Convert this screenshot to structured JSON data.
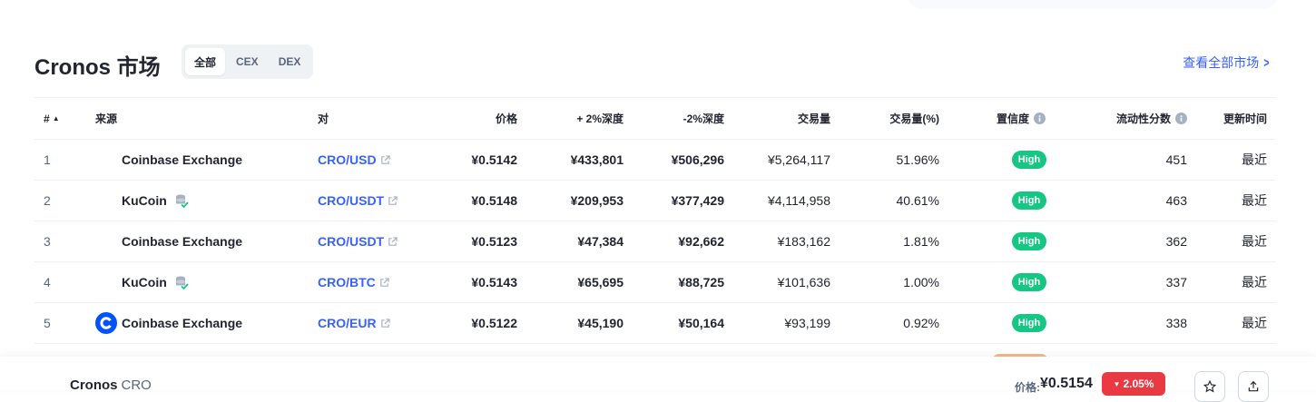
{
  "header": {
    "title": "Cronos 市场",
    "tabs": [
      "全部",
      "CEX",
      "DEX"
    ],
    "view_all": "查看全部市场"
  },
  "columns": {
    "num": "#",
    "source": "来源",
    "pair": "对",
    "price": "价格",
    "depth_plus": "+ 2%深度",
    "depth_minus": "-2%深度",
    "volume": "交易量",
    "volume_pct": "交易量(%)",
    "confidence": "置信度",
    "liquidity": "流动性分数",
    "updated": "更新时间"
  },
  "rows": [
    {
      "num": "1",
      "source": "Coinbase Exchange",
      "pair": "CRO/USD",
      "price": "¥0.5142",
      "depth_plus": "¥433,801",
      "depth_minus": "¥506,296",
      "volume": "¥5,264,117",
      "volume_pct": "51.96%",
      "confidence": "High",
      "liquidity": "451",
      "updated": "最近"
    },
    {
      "num": "2",
      "source": "KuCoin",
      "pair": "CRO/USDT",
      "price": "¥0.5148",
      "depth_plus": "¥209,953",
      "depth_minus": "¥377,429",
      "volume": "¥4,114,958",
      "volume_pct": "40.61%",
      "confidence": "High",
      "liquidity": "463",
      "updated": "最近"
    },
    {
      "num": "3",
      "source": "Coinbase Exchange",
      "pair": "CRO/USDT",
      "price": "¥0.5123",
      "depth_plus": "¥47,384",
      "depth_minus": "¥92,662",
      "volume": "¥183,162",
      "volume_pct": "1.81%",
      "confidence": "High",
      "liquidity": "362",
      "updated": "最近"
    },
    {
      "num": "4",
      "source": "KuCoin",
      "pair": "CRO/BTC",
      "price": "¥0.5143",
      "depth_plus": "¥65,695",
      "depth_minus": "¥88,725",
      "volume": "¥101,636",
      "volume_pct": "1.00%",
      "confidence": "High",
      "liquidity": "337",
      "updated": "最近"
    },
    {
      "num": "5",
      "source": "Coinbase Exchange",
      "pair": "CRO/EUR",
      "price": "¥0.5122",
      "depth_plus": "¥45,190",
      "depth_minus": "¥50,164",
      "volume": "¥93,199",
      "volume_pct": "0.92%",
      "confidence": "High",
      "liquidity": "338",
      "updated": "最近"
    }
  ],
  "bottom_bar": {
    "name": "Cronos",
    "symbol": "CRO",
    "price_label": "价格:",
    "price": "¥0.5154",
    "change": "2.05%"
  },
  "colors": {
    "accent": "#3861fb",
    "high_badge": "#16c784",
    "negative": "#ea3943",
    "coinbase": "#0052ff"
  }
}
